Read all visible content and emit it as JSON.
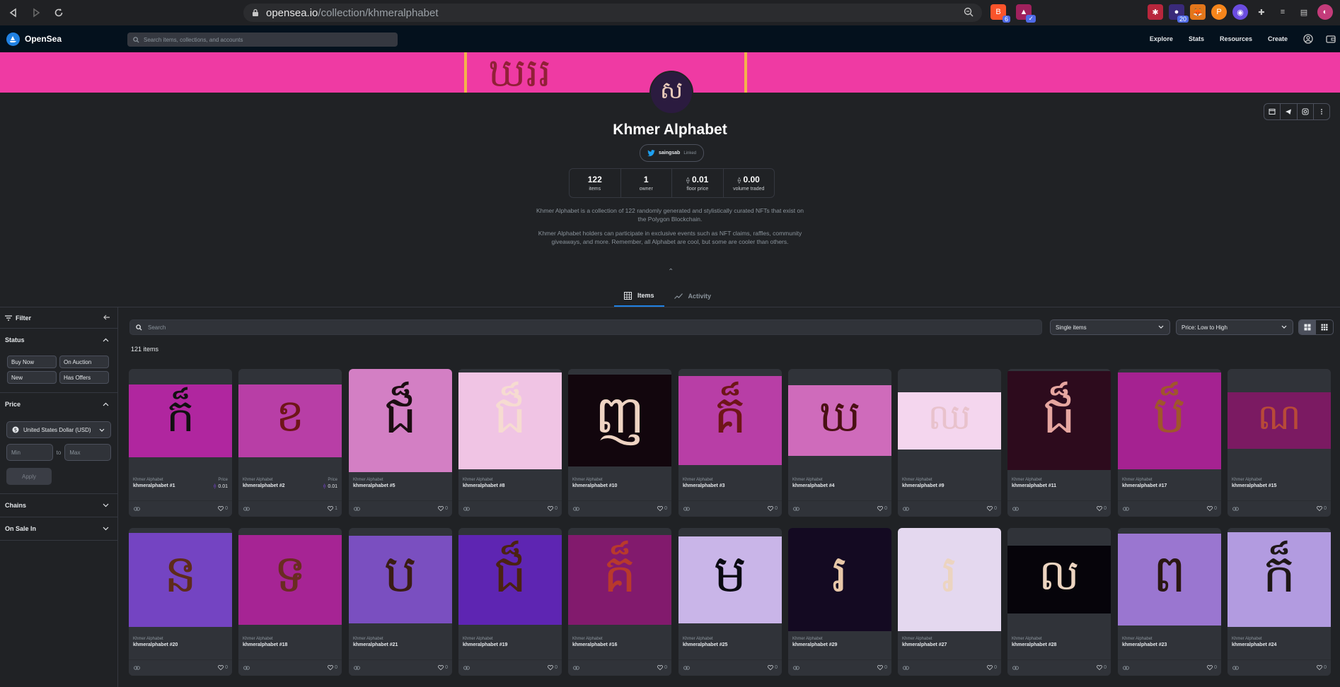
{
  "browser": {
    "url_host": "opensea.io",
    "url_path": "/collection/khmeralphabet",
    "brave_badge": "6",
    "ext_badge": "20"
  },
  "header": {
    "logo_text": "OpenSea",
    "search_placeholder": "Search items, collections, and accounts",
    "nav": [
      "Explore",
      "Stats",
      "Resources",
      "Create"
    ]
  },
  "collection": {
    "avatar_glyph": "ស",
    "title": "Khmer Alphabet",
    "twitter_handle": "saingsab",
    "twitter_linked": "Linked",
    "stats": [
      {
        "value": "122",
        "label": "items"
      },
      {
        "value": "1",
        "label": "owner"
      },
      {
        "value": "0.01",
        "label": "floor price",
        "eth": true
      },
      {
        "value": "0.00",
        "label": "volume traded",
        "eth": true
      }
    ],
    "description_1": "Khmer Alphabet is a collection of 122 randomly generated and stylistically curated NFTs that exist on the Polygon Blockchain.",
    "description_2": "Khmer Alphabet holders can participate in exclusive events such as NFT claims, raffles, community giveaways, and more. Remember, all Alphabet are cool, but some are cooler than others.",
    "banner_glyph": "ឃររ"
  },
  "tabs": [
    {
      "label": "Items",
      "active": true
    },
    {
      "label": "Activity",
      "active": false
    }
  ],
  "sidebar": {
    "title": "Filter",
    "status": {
      "title": "Status",
      "options": [
        "Buy Now",
        "On Auction",
        "New",
        "Has Offers"
      ]
    },
    "price": {
      "title": "Price",
      "currency": "United States Dollar (USD)",
      "min_placeholder": "Min",
      "to": "to",
      "max_placeholder": "Max",
      "apply": "Apply"
    },
    "chains": "Chains",
    "on_sale_in": "On Sale In"
  },
  "toolbar": {
    "search_placeholder": "Search",
    "items_select": "Single items",
    "sort_select": "Price: Low to High",
    "count": "121 items"
  },
  "colors": {
    "accent": "#2081e2",
    "banner": "#ef3aa3",
    "header_bg": "#04111d"
  },
  "cards": [
    {
      "collection": "Khmer Alphabet",
      "name": "khmeralphabet #1",
      "price_label": "Price",
      "price": "0.01",
      "likes": "0",
      "glyph": "ក៏",
      "bg": "#b0269f",
      "fg": "#111111",
      "img_h": 103
    },
    {
      "collection": "Khmer Alphabet",
      "name": "khmeralphabet #2",
      "price_label": "Price",
      "price": "0.01",
      "likes": "1",
      "glyph": "ខ",
      "bg": "#b83ea6",
      "fg": "#6e1518",
      "img_h": 103
    },
    {
      "collection": "Khmer Alphabet",
      "name": "khmeralphabet #5",
      "likes": "0",
      "glyph": "ជ៏",
      "bg": "#d37fc4",
      "fg": "#1c0d12",
      "img_h": 146
    },
    {
      "collection": "Khmer Alphabet",
      "name": "khmeralphabet #8",
      "likes": "0",
      "glyph": "ជ៏",
      "bg": "#f0c4e4",
      "fg": "#f6dbd1",
      "img_h": 137
    },
    {
      "collection": "Khmer Alphabet",
      "name": "khmeralphabet #10",
      "likes": "0",
      "glyph": "ញ",
      "bg": "#12060d",
      "fg": "#eed3c2",
      "img_h": 130
    },
    {
      "collection": "Khmer Alphabet",
      "name": "khmeralphabet #3",
      "likes": "0",
      "glyph": "គ៏",
      "bg": "#b83ea6",
      "fg": "#6e1518",
      "img_h": 126
    },
    {
      "collection": "Khmer Alphabet",
      "name": "khmeralphabet #4",
      "likes": "0",
      "glyph": "ឃ",
      "bg": "#cf6bbb",
      "fg": "#4a1014",
      "img_h": 100
    },
    {
      "collection": "Khmer Alphabet",
      "name": "khmeralphabet #9",
      "likes": "0",
      "glyph": "ឈ",
      "bg": "#f4d6ee",
      "fg": "#e8c2cc",
      "img_h": 81
    },
    {
      "collection": "Khmer Alphabet",
      "name": "khmeralphabet #11",
      "likes": "0",
      "glyph": "ជ៏",
      "bg": "#2d0b1d",
      "fg": "#e6a6a0",
      "img_h": 140
    },
    {
      "collection": "Khmer Alphabet",
      "name": "khmeralphabet #17",
      "likes": "0",
      "glyph": "ប៏",
      "bg": "#a52291",
      "fg": "#a0552c",
      "img_h": 137
    },
    {
      "collection": "Khmer Alphabet",
      "name": "khmeralphabet #15",
      "likes": "0",
      "glyph": "ណ",
      "bg": "#7b1a62",
      "fg": "#b84a38",
      "img_h": 80
    },
    {
      "collection": "Khmer Alphabet",
      "name": "khmeralphabet #20",
      "likes": "0",
      "glyph": "ន",
      "bg": "#7444c2",
      "fg": "#5e2b1b",
      "img_h": 133
    },
    {
      "collection": "Khmer Alphabet",
      "name": "khmeralphabet #18",
      "likes": "0",
      "glyph": "ទ",
      "bg": "#a62494",
      "fg": "#6a2c22",
      "img_h": 127
    },
    {
      "collection": "Khmer Alphabet",
      "name": "khmeralphabet #21",
      "likes": "0",
      "glyph": "ប",
      "bg": "#7a4fc0",
      "fg": "#3a1c14",
      "img_h": 124
    },
    {
      "collection": "Khmer Alphabet",
      "name": "khmeralphabet #19",
      "likes": "0",
      "glyph": "ជ៏",
      "bg": "#5e25b2",
      "fg": "#4b2212",
      "img_h": 127
    },
    {
      "collection": "Khmer Alphabet",
      "name": "khmeralphabet #16",
      "likes": "0",
      "glyph": "គ៏",
      "bg": "#821a6d",
      "fg": "#b8392c",
      "img_h": 127
    },
    {
      "collection": "Khmer Alphabet",
      "name": "khmeralphabet #25",
      "likes": "0",
      "glyph": "ម",
      "bg": "#c9b5e8",
      "fg": "#0a0a12",
      "img_h": 123
    },
    {
      "collection": "Khmer Alphabet",
      "name": "khmeralphabet #29",
      "likes": "0",
      "glyph": "រ",
      "bg": "#140a22",
      "fg": "#e8c7a8",
      "img_h": 146
    },
    {
      "collection": "Khmer Alphabet",
      "name": "khmeralphabet #27",
      "likes": "0",
      "glyph": "រ",
      "bg": "#e4d8ef",
      "fg": "#ecd4c0",
      "img_h": 146
    },
    {
      "collection": "Khmer Alphabet",
      "name": "khmeralphabet #28",
      "likes": "0",
      "glyph": "ល",
      "bg": "#06040a",
      "fg": "#ecd4c0",
      "img_h": 96
    },
    {
      "collection": "Khmer Alphabet",
      "name": "khmeralphabet #23",
      "likes": "0",
      "glyph": "ព",
      "bg": "#9a76d0",
      "fg": "#2a1712",
      "img_h": 130
    },
    {
      "collection": "Khmer Alphabet",
      "name": "khmeralphabet #24",
      "likes": "0",
      "glyph": "ក៏",
      "bg": "#b29be0",
      "fg": "#1e1716",
      "img_h": 134
    }
  ]
}
